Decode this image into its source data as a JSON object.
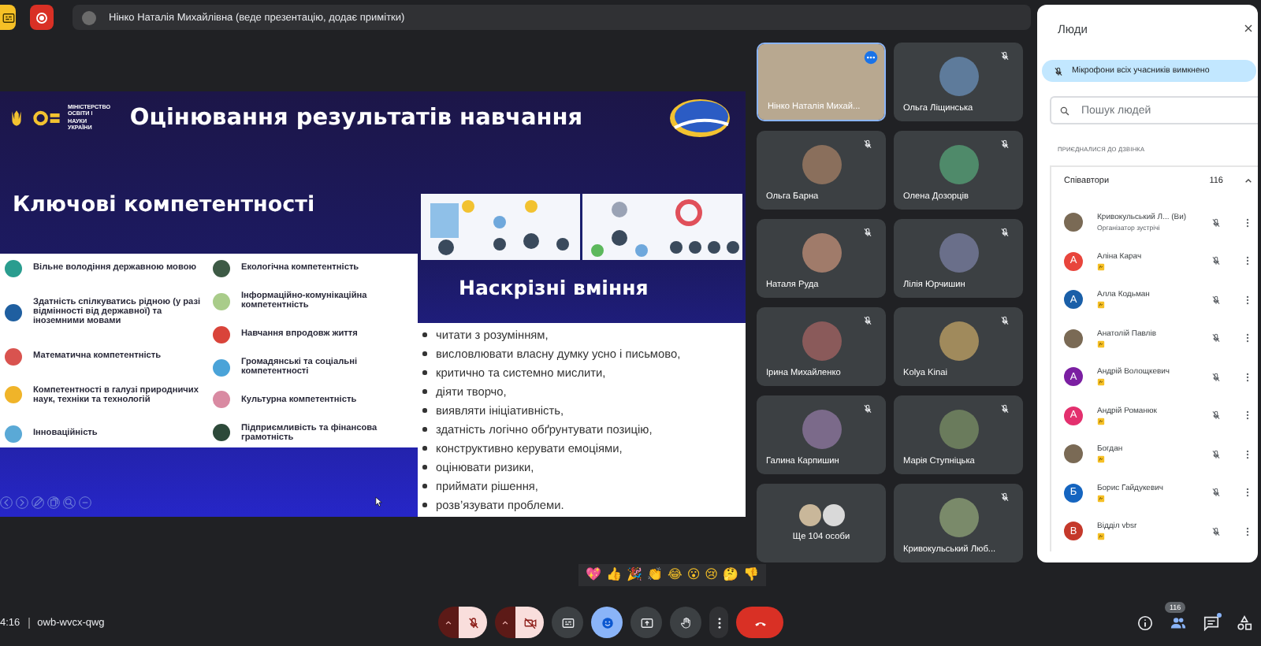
{
  "top_bar": {
    "buttons": [
      {
        "kind": "activity"
      },
      {
        "kind": "record"
      }
    ],
    "presenter_label": "Нінко Наталія Михайлівна (веде презентацію, додає примітки)"
  },
  "slide": {
    "ministry_text": "МІНІСТЕРСТВО ОСВІТИ І НАУКИ УКРАЇНИ",
    "title": "Оцінювання результатів навчання",
    "key_heading": "Ключові компетентності",
    "competence_columns": [
      [
        {
          "text": "Вільне володіння державною мовою",
          "color": "#2a9d8f"
        },
        {
          "text": "Здатність спілкуватись рідною (у разі відмінності від державної) та іноземними мовами",
          "color": "#1f5fa0"
        },
        {
          "text": "Математична компетентність",
          "color": "#d9534f"
        },
        {
          "text": "Компетентності в галузі природничих наук, техніки та технологій",
          "color": "#f0b429"
        },
        {
          "text": "Інноваційність",
          "color": "#5aa9d6"
        }
      ],
      [
        {
          "text": "Екологічна компетентність",
          "color": "#3d5a45"
        },
        {
          "text": "Інформаційно-комунікаційна компетентність",
          "color": "#a9cc8a"
        },
        {
          "text": "Навчання впродовж життя",
          "color": "#d9443a"
        },
        {
          "text": "Громадянські та соціальні компетентності",
          "color": "#4aa3d8"
        },
        {
          "text": "Культурна компетентність",
          "color": "#d98aa2"
        },
        {
          "text": "Підприємливість та фінансова грамотність",
          "color": "#2d4a3a"
        }
      ]
    ],
    "skills_heading": "Наскрізні вміння",
    "skills": [
      "читати з розумінням,",
      "висловлювати власну думку усно і письмово,",
      "критично та системно мислити,",
      "діяти творчо,",
      "виявляти ініціативність,",
      "здатність логічно обґрунтувати позицію,",
      "конструктивно керувати емоціями,",
      "оцінювати ризики,",
      "приймати рішення,",
      "розв’язувати проблеми."
    ]
  },
  "tiles": [
    {
      "name": "Нінко Наталія Михай...",
      "kind": "video",
      "selected": true,
      "muted": false
    },
    {
      "name": "Ольга Ліщинська",
      "kind": "person",
      "selected": false,
      "muted": true
    },
    {
      "name": "Ольга Барна",
      "kind": "person",
      "selected": false,
      "muted": true
    },
    {
      "name": "Олена Дозорців",
      "kind": "person",
      "selected": false,
      "muted": true
    },
    {
      "name": "Наталя Руда",
      "kind": "person",
      "selected": false,
      "muted": true
    },
    {
      "name": "Лілія Юрчишин",
      "kind": "person",
      "selected": false,
      "muted": true
    },
    {
      "name": "Ірина Михайленко",
      "kind": "person",
      "selected": false,
      "muted": true
    },
    {
      "name": "Kolya Kinai",
      "kind": "person",
      "selected": false,
      "muted": true
    },
    {
      "name": "Галина Карпишин",
      "kind": "person",
      "selected": false,
      "muted": true
    },
    {
      "name": "Марія Ступніцька",
      "kind": "person",
      "selected": false,
      "muted": true
    },
    {
      "name": "Ще 104 особи",
      "kind": "others",
      "selected": false,
      "muted": false
    },
    {
      "name": "Кривокульський Люб...",
      "kind": "person",
      "selected": false,
      "muted": true
    }
  ],
  "reactions": [
    "💖",
    "👍",
    "🎉",
    "👏",
    "😂",
    "😮",
    "😢",
    "🤔",
    "👎"
  ],
  "bottom_bar": {
    "clock": "4:16",
    "meeting_code": "owb-wvcx-qwg",
    "controls": [
      {
        "kind": "mic",
        "on": false
      },
      {
        "kind": "camera",
        "on": false
      },
      {
        "kind": "captions",
        "selected": false
      },
      {
        "kind": "reactions",
        "selected": true
      },
      {
        "kind": "present",
        "selected": false
      },
      {
        "kind": "hand",
        "selected": false
      },
      {
        "kind": "more",
        "selected": false
      },
      {
        "kind": "end"
      }
    ],
    "side_buttons": [
      {
        "kind": "info",
        "selected": false
      },
      {
        "kind": "people",
        "selected": true,
        "count": "116"
      },
      {
        "kind": "chat",
        "selected": false
      },
      {
        "kind": "activities",
        "selected": false
      }
    ]
  },
  "people_panel": {
    "title": "Люди",
    "banner": "Мікрофони всіх учасників вимкнено",
    "search": {
      "placeholder": "Пошук людей"
    },
    "section": "ПРИЄДНАЛИСЯ ДО ДЗВІНКА",
    "group": {
      "label": "Співавтори",
      "count": "116",
      "expanded": true
    },
    "people": [
      {
        "name": "Кривокульський Л... (Ви)",
        "subtitle": "Організатор зустрічі",
        "kind": "photo",
        "badge": false,
        "muted": true
      },
      {
        "name": "Аліна Карач",
        "kind": "letter",
        "letter": "А",
        "color": "#e8453c",
        "badge": true,
        "muted": true
      },
      {
        "name": "Алла Кодьман",
        "kind": "letter",
        "letter": "А",
        "color": "#1a5fa8",
        "badge": true,
        "muted": true
      },
      {
        "name": "Анатолій Павлів",
        "kind": "photo",
        "badge": true,
        "muted": true
      },
      {
        "name": "Андрій Волощкевич",
        "kind": "letter",
        "letter": "А",
        "color": "#7b1fa2",
        "badge": true,
        "muted": true
      },
      {
        "name": "Андрій Романюк",
        "kind": "letter",
        "letter": "А",
        "color": "#e3306e",
        "badge": true,
        "muted": true
      },
      {
        "name": "Богдан",
        "kind": "photo",
        "badge": true,
        "muted": true
      },
      {
        "name": "Борис Гайдукевич",
        "kind": "letter",
        "letter": "Б",
        "color": "#1565c0",
        "badge": true,
        "muted": true
      },
      {
        "name": "Відділ vbsr",
        "kind": "letter",
        "letter": "В",
        "color": "#c5392b",
        "badge": true,
        "muted": true
      }
    ]
  }
}
